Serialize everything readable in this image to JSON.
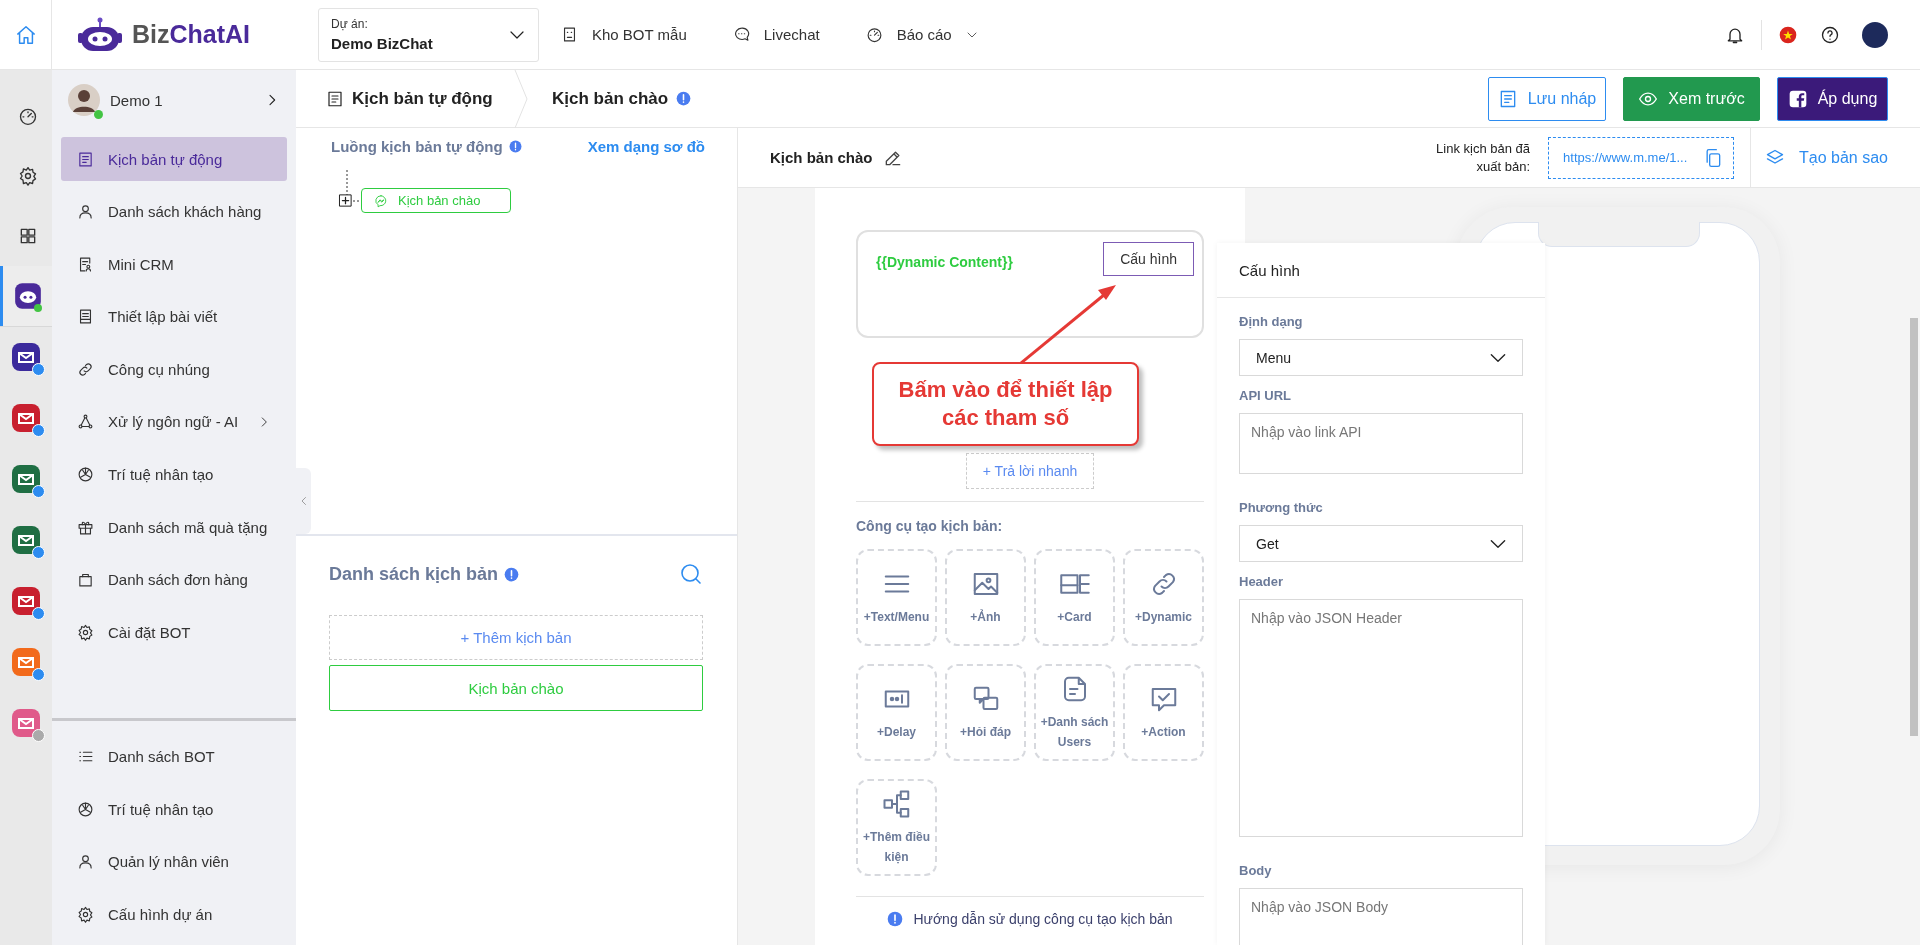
{
  "topbar": {
    "logo_left": "Biz",
    "logo_right": "ChatAI",
    "project": {
      "label": "Dự án:",
      "value": "Demo BizChat"
    },
    "nav": [
      {
        "label": "Kho BOT mẫu",
        "kind": "bot-doc",
        "dropdown": false
      },
      {
        "label": "Livechat",
        "kind": "chat",
        "dropdown": false
      },
      {
        "label": "Báo cáo",
        "kind": "gauge",
        "dropdown": true
      }
    ]
  },
  "rail": {
    "items": [
      {
        "kind": "gauge",
        "selected": false
      },
      {
        "kind": "gear",
        "selected": false
      },
      {
        "kind": "grid",
        "selected": false
      },
      {
        "kind": "bot",
        "selected": true
      }
    ],
    "apps": [
      {
        "color": "#3b2a9c",
        "disabled": false
      },
      {
        "color": "#c8202f",
        "disabled": false
      },
      {
        "color": "#1f6e43",
        "disabled": false
      },
      {
        "color": "#1f6e43",
        "disabled": false
      },
      {
        "color": "#c8202f",
        "disabled": false
      },
      {
        "color": "#f26a1b",
        "disabled": false
      },
      {
        "color": "#e05a8a",
        "disabled": true
      }
    ]
  },
  "sidebar": {
    "user": "Demo 1",
    "online": true,
    "items": [
      {
        "label": "Kịch bản tự động",
        "kind": "list-doc",
        "selected": true,
        "submenu": false
      },
      {
        "label": "Danh sách khách hàng",
        "kind": "user",
        "selected": false,
        "submenu": false
      },
      {
        "label": "Mini CRM",
        "kind": "crm",
        "selected": false,
        "submenu": false
      },
      {
        "label": "Thiết lập bài viết",
        "kind": "doc",
        "selected": false,
        "submenu": false
      },
      {
        "label": "Công cụ nhúng",
        "kind": "link",
        "selected": false,
        "submenu": false
      },
      {
        "label": "Xử lý ngôn ngữ - AI",
        "kind": "nodes",
        "selected": false,
        "submenu": true
      },
      {
        "label": "Trí tuệ nhân tạo",
        "kind": "ai",
        "selected": false,
        "submenu": false
      },
      {
        "label": "Danh sách mã quà tặng",
        "kind": "gift",
        "selected": false,
        "submenu": false
      },
      {
        "label": "Danh sách đơn hàng",
        "kind": "bag",
        "selected": false,
        "submenu": false
      },
      {
        "label": "Cài đặt BOT",
        "kind": "gear",
        "selected": false,
        "submenu": false
      }
    ],
    "bottom_items": [
      {
        "label": "Danh sách BOT",
        "kind": "list"
      },
      {
        "label": "Trí tuệ nhân tạo",
        "kind": "ai"
      },
      {
        "label": "Quản lý nhân viên",
        "kind": "user"
      },
      {
        "label": "Cấu hình dự án",
        "kind": "gear"
      }
    ]
  },
  "breadcrumb": [
    "Kịch bản tự động",
    "Kịch bản chào"
  ],
  "actions": [
    {
      "label": "Lưu nháp",
      "kind": "draft"
    },
    {
      "label": "Xem trước",
      "kind": "preview"
    },
    {
      "label": "Áp dụng",
      "kind": "apply"
    }
  ],
  "flow": {
    "title": "Luồng kịch bản tự động",
    "view_link": "Xem dạng sơ đồ",
    "nodes": [
      {
        "label": "Kịch bản chào"
      }
    ]
  },
  "scripts": {
    "title": "Danh sách kịch bản",
    "add": "+ Thêm kịch bản",
    "items": [
      {
        "label": "Kịch bản chào",
        "selected": true
      }
    ]
  },
  "editor": {
    "title": "Kịch bản chào",
    "link_label": "Link kịch bản đã xuất bản:",
    "link_url": "https://www.m.me/1...",
    "copy_label": "Tạo bản sao",
    "dynamic_content": "{{Dynamic Content}}",
    "config_button": "Cấu hình",
    "quick_reply": "+ Trả lời nhanh",
    "tools_title": "Công cụ tạo kịch bản:",
    "tools": [
      {
        "label": "+Text/Menu",
        "kind": "text"
      },
      {
        "label": "+Ảnh",
        "kind": "image"
      },
      {
        "label": "+Card",
        "kind": "card"
      },
      {
        "label": "+Dynamic",
        "kind": "dynamic"
      },
      {
        "label": "+Delay",
        "kind": "delay"
      },
      {
        "label": "+Hỏi đáp",
        "kind": "qa"
      },
      {
        "label": "+Danh sách Users",
        "kind": "users"
      },
      {
        "label": "+Action",
        "kind": "action"
      },
      {
        "label": "+Thêm điều kiện",
        "kind": "condition"
      }
    ],
    "help": "Hướng dẫn sử dụng công cụ tạo kịch bản"
  },
  "callout": "Bấm vào để thiết lập các tham số",
  "config_panel": {
    "title": "Cấu hình",
    "fields": [
      {
        "label": "Định dạng",
        "kind": "select",
        "value": "Menu"
      },
      {
        "label": "API URL",
        "kind": "text",
        "placeholder": "Nhập vào link API"
      },
      {
        "label": "Phương thức",
        "kind": "select",
        "value": "Get"
      },
      {
        "label": "Header",
        "kind": "textarea",
        "placeholder": "Nhập vào JSON Header"
      },
      {
        "label": "Body",
        "kind": "textarea",
        "placeholder": "Nhập vào JSON Body"
      }
    ]
  }
}
